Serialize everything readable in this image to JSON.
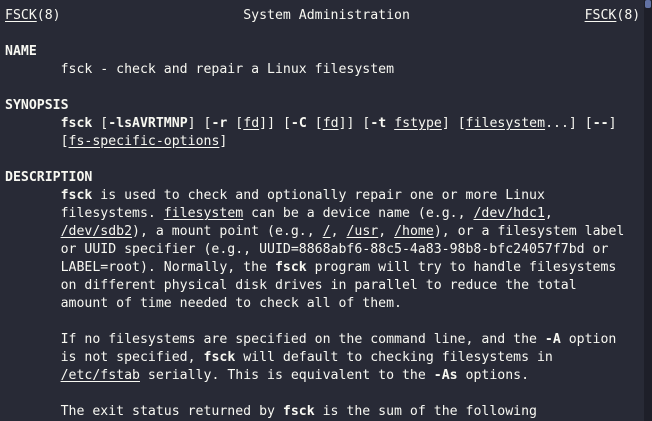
{
  "app": {
    "fg": "#f8f8f2",
    "bg": "#282a36"
  },
  "manpage": {
    "lines": [
      [
        [
          "FSCK",
          "u"
        ],
        [
          "(8)                       System Administration                      ",
          ""
        ],
        [
          "FSCK",
          "u"
        ],
        [
          "(8)",
          ""
        ]
      ],
      [],
      [
        [
          "NAME",
          "b"
        ]
      ],
      [
        [
          "       fsck - check and repair a Linux filesystem",
          ""
        ]
      ],
      [],
      [
        [
          "SYNOPSIS",
          "b"
        ]
      ],
      [
        [
          "       ",
          ""
        ],
        [
          "fsck",
          "b"
        ],
        [
          " [",
          ""
        ],
        [
          "-lsAVRTMNP",
          "b"
        ],
        [
          "] [",
          ""
        ],
        [
          "-r",
          "b"
        ],
        [
          " [",
          ""
        ],
        [
          "fd",
          "u"
        ],
        [
          "]] [",
          ""
        ],
        [
          "-C",
          "b"
        ],
        [
          " [",
          ""
        ],
        [
          "fd",
          "u"
        ],
        [
          "]] [",
          ""
        ],
        [
          "-t",
          "b"
        ],
        [
          " ",
          ""
        ],
        [
          "fstype",
          "u"
        ],
        [
          "] [",
          ""
        ],
        [
          "filesystem",
          "u"
        ],
        [
          "...] [",
          ""
        ],
        [
          "--",
          "b"
        ],
        [
          "]",
          ""
        ]
      ],
      [
        [
          "       [",
          ""
        ],
        [
          "fs-specific-options",
          "u"
        ],
        [
          "]",
          ""
        ]
      ],
      [],
      [
        [
          "DESCRIPTION",
          "b"
        ]
      ],
      [
        [
          "       ",
          ""
        ],
        [
          "fsck",
          "b"
        ],
        [
          " is used to check and optionally repair one or more Linux",
          ""
        ]
      ],
      [
        [
          "       filesystems. ",
          ""
        ],
        [
          "filesystem",
          "u"
        ],
        [
          " can be a device name (e.g., ",
          ""
        ],
        [
          "/dev/hdc1",
          "u"
        ],
        [
          ",",
          ""
        ]
      ],
      [
        [
          "       ",
          ""
        ],
        [
          "/dev/sdb2",
          "u"
        ],
        [
          "), a mount point (e.g., ",
          ""
        ],
        [
          "/",
          "u"
        ],
        [
          ", ",
          ""
        ],
        [
          "/usr",
          "u"
        ],
        [
          ", ",
          ""
        ],
        [
          "/home",
          "u"
        ],
        [
          "), or a filesystem label",
          ""
        ]
      ],
      [
        [
          "       or UUID specifier (e.g., UUID=8868abf6-88c5-4a83-98b8-bfc24057f7bd or",
          ""
        ]
      ],
      [
        [
          "       LABEL=root). Normally, the ",
          ""
        ],
        [
          "fsck",
          "b"
        ],
        [
          " program will try to handle filesystems",
          ""
        ]
      ],
      [
        [
          "       on different physical disk drives in parallel to reduce the total",
          ""
        ]
      ],
      [
        [
          "       amount of time needed to check all of them.",
          ""
        ]
      ],
      [],
      [
        [
          "       If no filesystems are specified on the command line, and the ",
          ""
        ],
        [
          "-A",
          "b"
        ],
        [
          " option",
          ""
        ]
      ],
      [
        [
          "       is not specified, ",
          ""
        ],
        [
          "fsck",
          "b"
        ],
        [
          " will default to checking filesystems in",
          ""
        ]
      ],
      [
        [
          "       ",
          ""
        ],
        [
          "/etc/fstab",
          "u"
        ],
        [
          " serially. This is equivalent to the ",
          ""
        ],
        [
          "-As",
          "b"
        ],
        [
          " options.",
          ""
        ]
      ],
      [],
      [
        [
          "       The exit status returned by ",
          ""
        ],
        [
          "fsck",
          "b"
        ],
        [
          " is the sum of the following",
          ""
        ]
      ]
    ]
  }
}
